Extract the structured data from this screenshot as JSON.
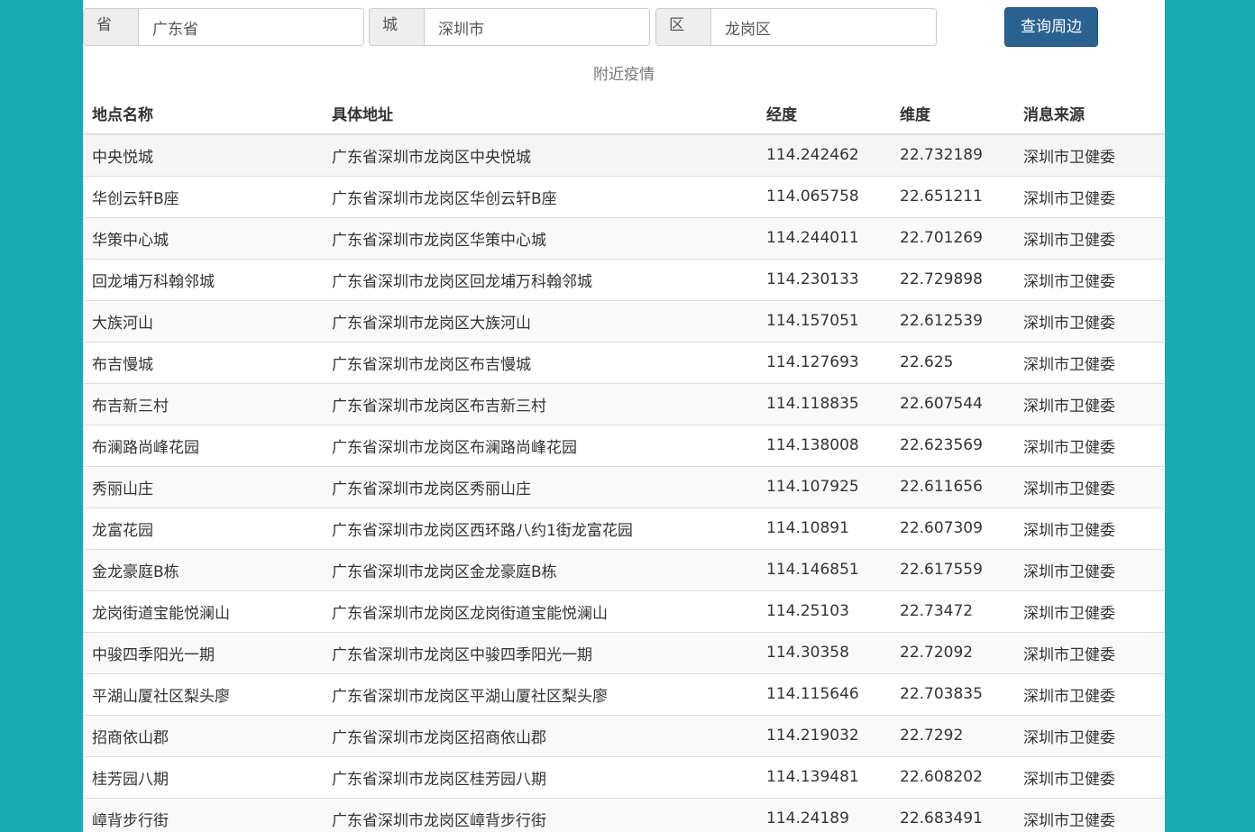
{
  "search": {
    "province_label": "省份:",
    "province_value": "广东省",
    "city_label": "城市:",
    "city_value": "深圳市",
    "district_label": "区县:",
    "district_value": "龙岗区",
    "query_button": "查询周边"
  },
  "caption": "附近疫情",
  "table": {
    "headers": [
      "地点名称",
      "具体地址",
      "经度",
      "维度",
      "消息来源"
    ],
    "rows": [
      [
        "中央悦城",
        "广东省深圳市龙岗区中央悦城",
        "114.242462",
        "22.732189",
        "深圳市卫健委"
      ],
      [
        "华创云轩B座",
        "广东省深圳市龙岗区华创云轩B座",
        "114.065758",
        "22.651211",
        "深圳市卫健委"
      ],
      [
        "华策中心城",
        "广东省深圳市龙岗区华策中心城",
        "114.244011",
        "22.701269",
        "深圳市卫健委"
      ],
      [
        "回龙埔万科翰邻城",
        "广东省深圳市龙岗区回龙埔万科翰邻城",
        "114.230133",
        "22.729898",
        "深圳市卫健委"
      ],
      [
        "大族河山",
        "广东省深圳市龙岗区大族河山",
        "114.157051",
        "22.612539",
        "深圳市卫健委"
      ],
      [
        "布吉慢城",
        "广东省深圳市龙岗区布吉慢城",
        "114.127693",
        "22.625",
        "深圳市卫健委"
      ],
      [
        "布吉新三村",
        "广东省深圳市龙岗区布吉新三村",
        "114.118835",
        "22.607544",
        "深圳市卫健委"
      ],
      [
        "布澜路尚峰花园",
        "广东省深圳市龙岗区布澜路尚峰花园",
        "114.138008",
        "22.623569",
        "深圳市卫健委"
      ],
      [
        "秀丽山庄",
        "广东省深圳市龙岗区秀丽山庄",
        "114.107925",
        "22.611656",
        "深圳市卫健委"
      ],
      [
        "龙富花园",
        "广东省深圳市龙岗区西环路八约1街龙富花园",
        "114.10891",
        "22.607309",
        "深圳市卫健委"
      ],
      [
        "金龙豪庭B栋",
        "广东省深圳市龙岗区金龙豪庭B栋",
        "114.146851",
        "22.617559",
        "深圳市卫健委"
      ],
      [
        "龙岗街道宝能悦澜山",
        "广东省深圳市龙岗区龙岗街道宝能悦澜山",
        "114.25103",
        "22.73472",
        "深圳市卫健委"
      ],
      [
        "中骏四季阳光一期",
        "广东省深圳市龙岗区中骏四季阳光一期",
        "114.30358",
        "22.72092",
        "深圳市卫健委"
      ],
      [
        "平湖山厦社区梨头廖",
        "广东省深圳市龙岗区平湖山厦社区梨头廖",
        "114.115646",
        "22.703835",
        "深圳市卫健委"
      ],
      [
        "招商依山郡",
        "广东省深圳市龙岗区招商依山郡",
        "114.219032",
        "22.7292",
        "深圳市卫健委"
      ],
      [
        "桂芳园八期",
        "广东省深圳市龙岗区桂芳园八期",
        "114.139481",
        "22.608202",
        "深圳市卫健委"
      ],
      [
        "嶂背步行街",
        "广东省深圳市龙岗区嶂背步行街",
        "114.24189",
        "22.683491",
        "深圳市卫健委"
      ]
    ]
  }
}
